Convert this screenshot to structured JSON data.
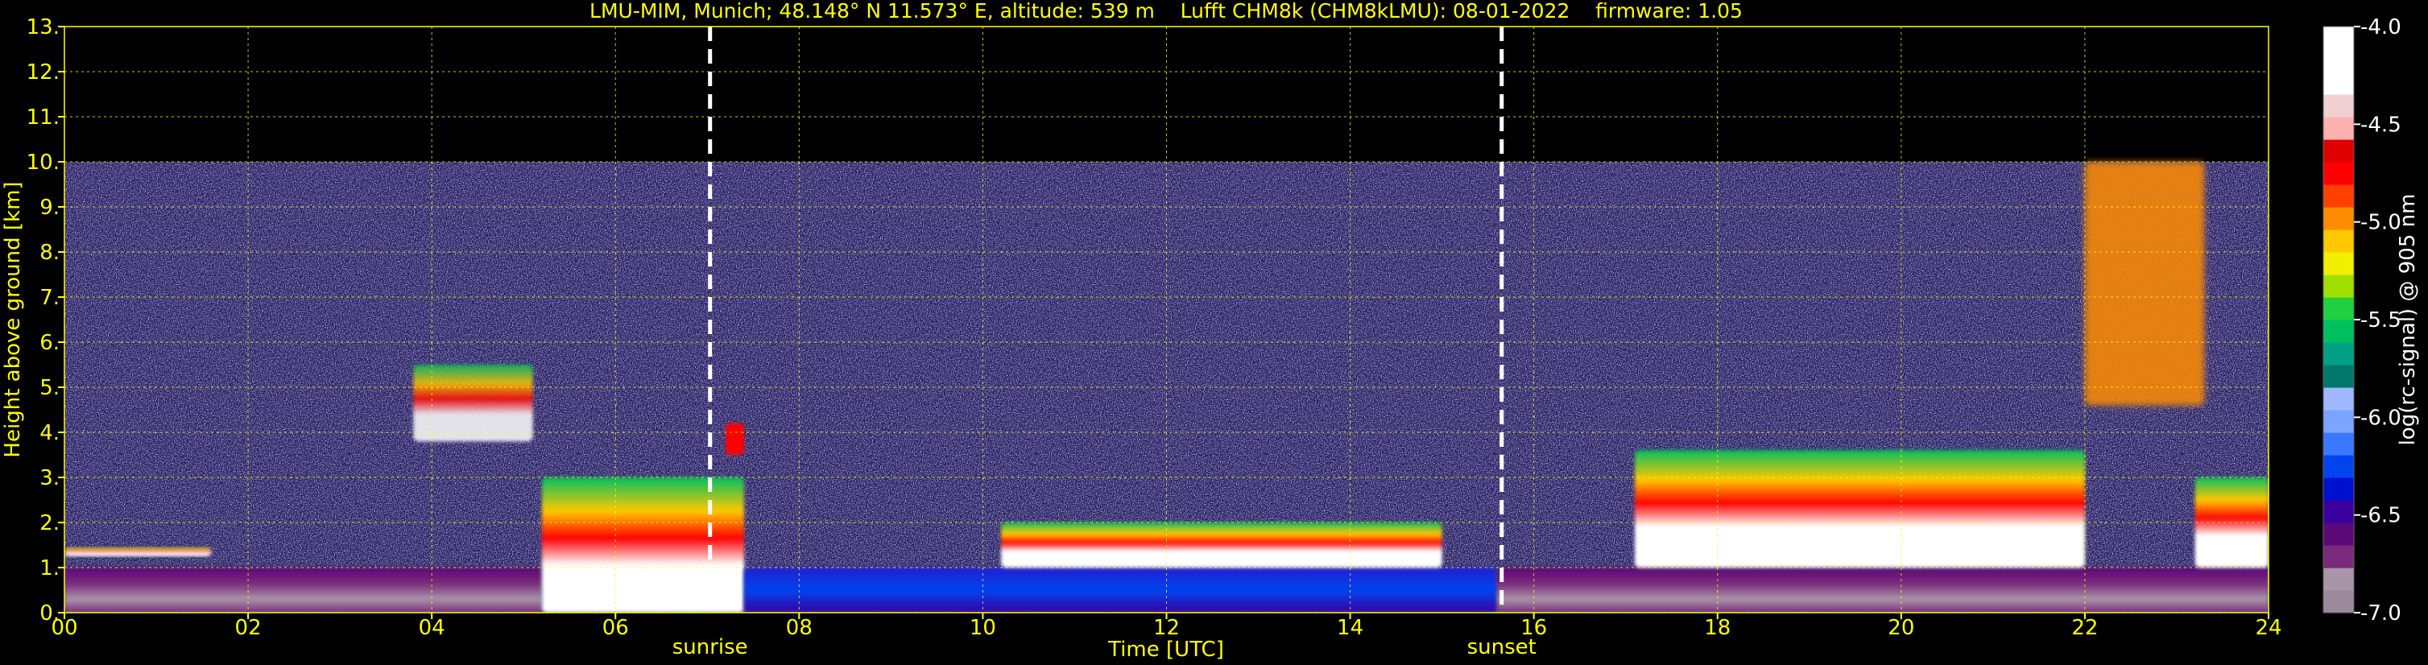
{
  "title": "LMU-MIM, Munich; 48.148° N 11.573° E, altitude: 539 m    Lufft CHM8k (CHM8kLMU): 08-01-2022    firmware: 1.05",
  "chart_data": {
    "type": "heatmap",
    "title": "LMU-MIM, Munich; 48.148° N 11.573° E, altitude: 539 m    Lufft CHM8k (CHM8kLMU): 08-01-2022    firmware: 1.05",
    "xlabel": "Time [UTC]",
    "ylabel": "Height above ground [km]",
    "xlim": [
      0,
      24
    ],
    "ylim": [
      0,
      13
    ],
    "x_ticks": [
      "00",
      "02",
      "04",
      "06",
      "08",
      "10",
      "12",
      "14",
      "16",
      "18",
      "20",
      "22",
      "24"
    ],
    "y_ticks": [
      "0.",
      "1.",
      "2.",
      "3.",
      "4.",
      "5.",
      "6.",
      "7.",
      "8.",
      "9.",
      "10.",
      "11.",
      "12.",
      "13."
    ],
    "grid": true,
    "data_top_km": 10,
    "markers": [
      {
        "label": "sunrise",
        "time": 7.03
      },
      {
        "label": "sunset",
        "time": 15.65
      }
    ],
    "colorbar": {
      "label": "log(rc-signal) @ 905 nm",
      "range": [
        -7.0,
        -4.0
      ],
      "ticks": [
        "-4.0",
        "-4.5",
        "-5.0",
        "-5.5",
        "-6.0",
        "-6.5",
        "-7.0"
      ],
      "colors": [
        "#9a8a9a",
        "#a896a8",
        "#7a2a7a",
        "#5a0a78",
        "#3a00a0",
        "#0010d0",
        "#0044f0",
        "#3a78ff",
        "#7aa4ff",
        "#a0b8ff",
        "#00786a",
        "#00a084",
        "#00c060",
        "#20d040",
        "#a0e000",
        "#f0f000",
        "#ffc800",
        "#ff8c00",
        "#ff4000",
        "#ff0000",
        "#e00000",
        "#ffb0b0",
        "#f0d0d0",
        "#ffffff",
        "#ffffff",
        "#ffffff"
      ]
    },
    "features": [
      {
        "name": "nocturnal boundary layer",
        "t_start": 0,
        "t_end": 5.2,
        "h_min": 0,
        "h_max": 1.0,
        "level": -6.8
      },
      {
        "name": "residual layer top",
        "t_start": 0,
        "t_end": 1.6,
        "h_min": 1.25,
        "h_max": 1.45,
        "level": -4.2
      },
      {
        "name": "elevated cloud",
        "t_start": 3.8,
        "t_end": 5.1,
        "h_min": 3.8,
        "h_max": 5.5,
        "level": -4.3
      },
      {
        "name": "morning low cloud",
        "t_start": 5.2,
        "t_end": 7.4,
        "h_min": 0,
        "h_max": 3.0,
        "level": -4.2
      },
      {
        "name": "cloud near 4 km",
        "t_start": 7.2,
        "t_end": 7.4,
        "h_min": 3.5,
        "h_max": 4.2,
        "level": -4.8
      },
      {
        "name": "convective boundary layer",
        "t_start": 7.4,
        "t_end": 15.6,
        "h_min": 0,
        "h_max": 1.0,
        "level": -6.3
      },
      {
        "name": "boundary layer clouds",
        "t_start": 10.2,
        "t_end": 15.0,
        "h_min": 1.0,
        "h_max": 2.0,
        "level": -4.3
      },
      {
        "name": "evening boundary layer",
        "t_start": 15.6,
        "t_end": 24,
        "h_min": 0,
        "h_max": 1.0,
        "level": -6.8
      },
      {
        "name": "mid-level cloud deck",
        "t_start": 17.1,
        "t_end": 22.0,
        "h_min": 1.0,
        "h_max": 3.6,
        "level": -4.2
      },
      {
        "name": "cirrus",
        "t_start": 22.0,
        "t_end": 23.3,
        "h_min": 4.6,
        "h_max": 10.0,
        "level": -5.0
      },
      {
        "name": "late low cloud",
        "t_start": 23.2,
        "t_end": 24,
        "h_min": 1.0,
        "h_max": 3.0,
        "level": -4.2
      }
    ]
  }
}
